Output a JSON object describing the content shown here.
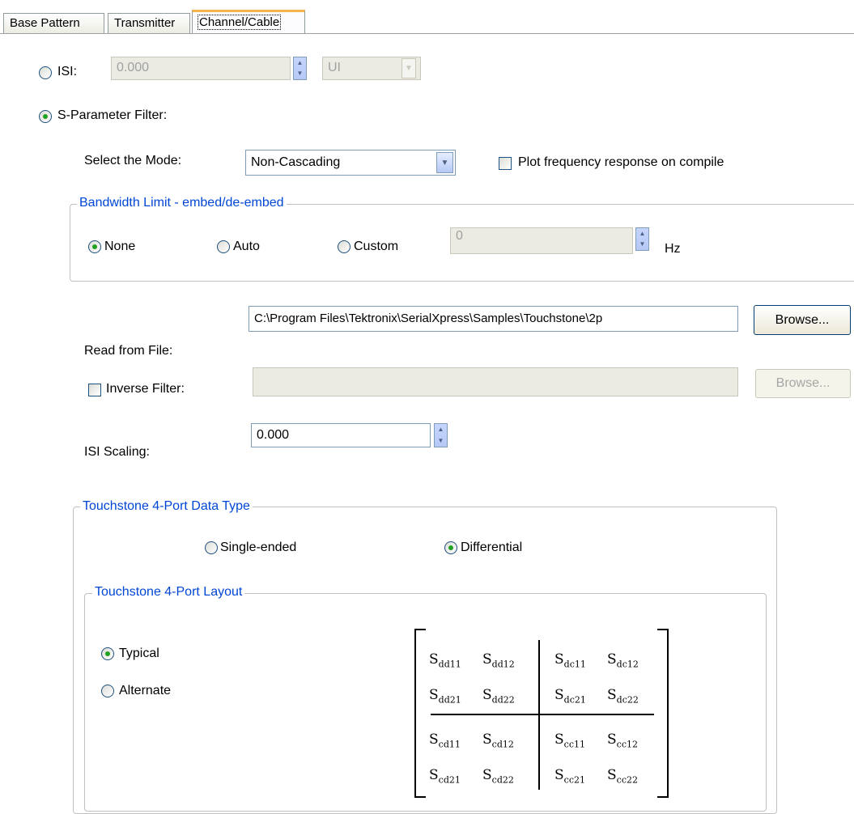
{
  "tabs": [
    {
      "label": "Base Pattern"
    },
    {
      "label": "Transmitter"
    },
    {
      "label": "Channel/Cable"
    }
  ],
  "isi": {
    "radio_label": "ISI:",
    "value": "0.000",
    "unit": "UI",
    "selected": false
  },
  "sparam": {
    "radio_label": "S-Parameter Filter:",
    "selected": true,
    "mode_label": "Select the Mode:",
    "mode_value": "Non-Cascading",
    "plot_checkbox_label": "Plot frequency response on compile",
    "plot_checked": false
  },
  "bandwidth": {
    "title": "Bandwidth Limit - embed/de-embed",
    "options": [
      "None",
      "Auto",
      "Custom"
    ],
    "selected": "None",
    "custom_value": "0",
    "unit": "Hz"
  },
  "file": {
    "label": "Read from File:",
    "path": "C:\\Program Files\\Tektronix\\SerialXpress\\Samples\\Touchstone\\2p",
    "browse_label": "Browse..."
  },
  "inverse": {
    "label": "Inverse Filter:",
    "checked": false,
    "path": "",
    "browse_label": "Browse..."
  },
  "scaling": {
    "label": "ISI Scaling:",
    "value": "0.000"
  },
  "datatype": {
    "title": "Touchstone 4-Port Data Type",
    "options": [
      "Single-ended",
      "Differential"
    ],
    "selected": "Differential"
  },
  "layout": {
    "title": "Touchstone 4-Port Layout",
    "options": [
      "Typical",
      "Alternate"
    ],
    "selected": "Typical",
    "matrix": [
      [
        {
          "s": "S",
          "sub": "dd11"
        },
        {
          "s": "S",
          "sub": "dd12"
        },
        {
          "s": "S",
          "sub": "dc11"
        },
        {
          "s": "S",
          "sub": "dc12"
        }
      ],
      [
        {
          "s": "S",
          "sub": "dd21"
        },
        {
          "s": "S",
          "sub": "dd22"
        },
        {
          "s": "S",
          "sub": "dc21"
        },
        {
          "s": "S",
          "sub": "dc22"
        }
      ],
      [
        {
          "s": "S",
          "sub": "cd11"
        },
        {
          "s": "S",
          "sub": "cd12"
        },
        {
          "s": "S",
          "sub": "cc11"
        },
        {
          "s": "S",
          "sub": "cc12"
        }
      ],
      [
        {
          "s": "S",
          "sub": "cd21"
        },
        {
          "s": "S",
          "sub": "cd22"
        },
        {
          "s": "S",
          "sub": "cc21"
        },
        {
          "s": "S",
          "sub": "cc22"
        }
      ]
    ]
  }
}
